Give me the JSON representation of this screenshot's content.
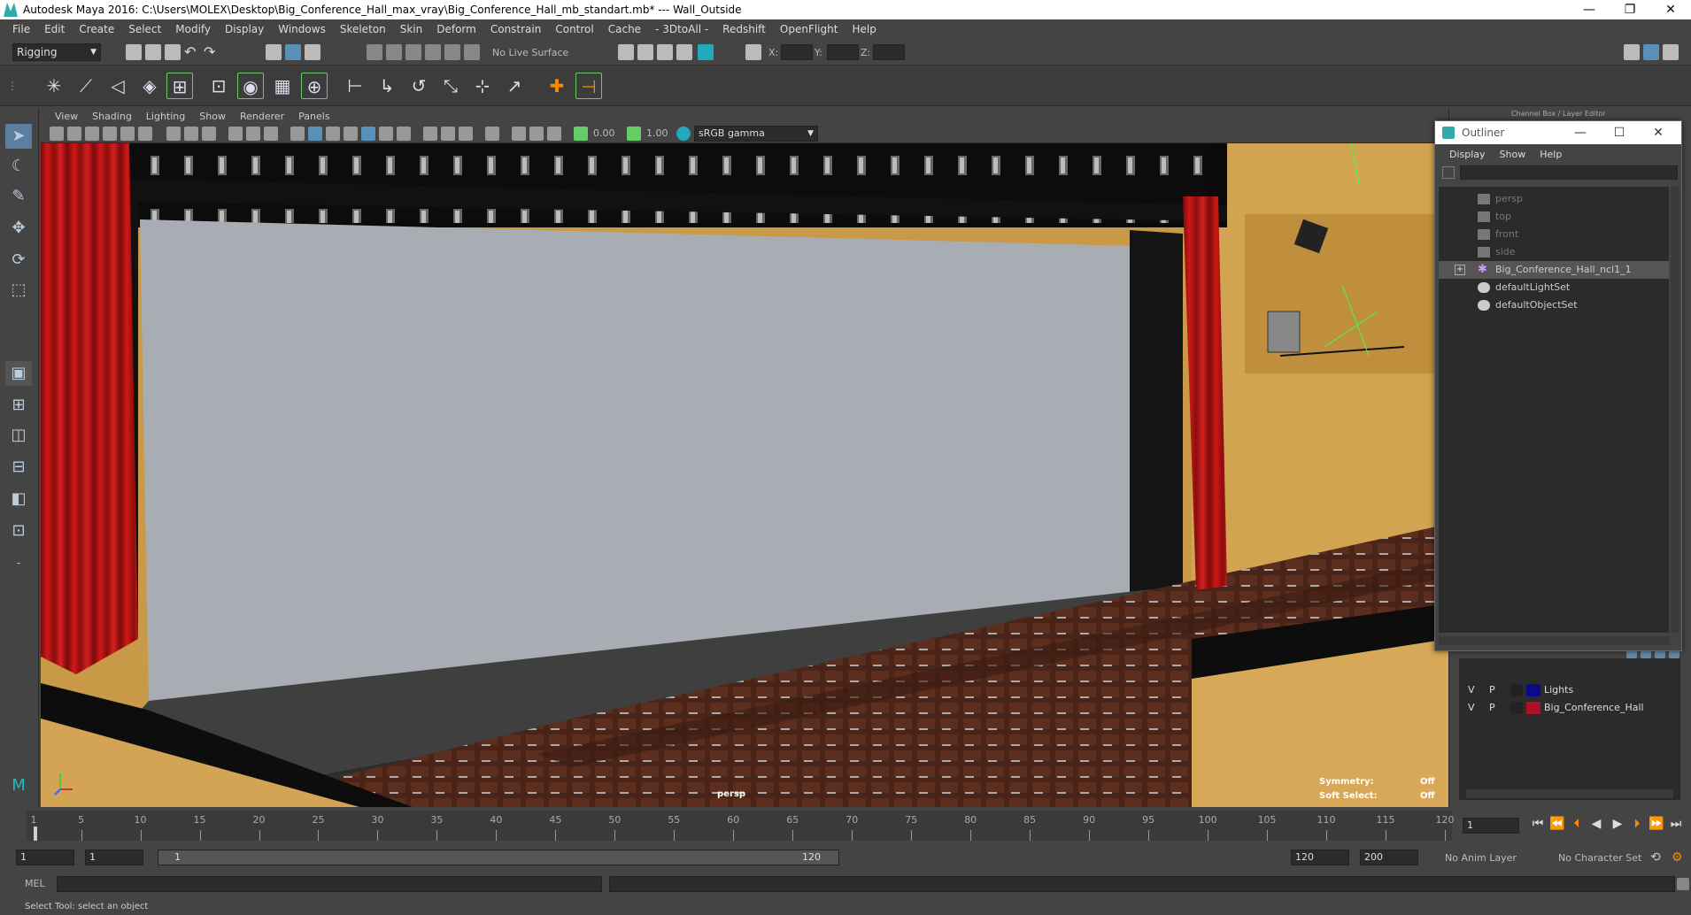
{
  "window": {
    "title": "Autodesk Maya 2016: C:\\Users\\MOLEX\\Desktop\\Big_Conference_Hall_max_vray\\Big_Conference_Hall_mb_standart.mb*   ---   Wall_Outside",
    "minimize": "—",
    "restore": "❐",
    "close": "✕"
  },
  "menubar": [
    "File",
    "Edit",
    "Create",
    "Select",
    "Modify",
    "Display",
    "Windows",
    "Skeleton",
    "Skin",
    "Deform",
    "Constrain",
    "Control",
    "Cache",
    "- 3DtoAll -",
    "Redshift",
    "OpenFlight",
    "Help"
  ],
  "statusline": {
    "menuset": "Rigging",
    "live_surface": "No Live Surface",
    "x_label": "X:",
    "y_label": "Y:",
    "z_label": "Z:"
  },
  "viewport": {
    "menu": [
      "View",
      "Shading",
      "Lighting",
      "Show",
      "Renderer",
      "Panels"
    ],
    "exposure": "0.00",
    "gamma": "1.00",
    "color_space": "sRGB gamma",
    "camera_label": "persp",
    "symmetry_label": "Symmetry:",
    "symmetry_value": "Off",
    "soft_select_label": "Soft Select:",
    "soft_select_value": "Off"
  },
  "channel_box_title": "Channel Box / Layer Editor",
  "outliner": {
    "title": "Outliner",
    "menu": [
      "Display",
      "Show",
      "Help"
    ],
    "items": [
      {
        "label": "persp",
        "type": "camera",
        "dim": true
      },
      {
        "label": "top",
        "type": "camera",
        "dim": true
      },
      {
        "label": "front",
        "type": "camera",
        "dim": true
      },
      {
        "label": "side",
        "type": "camera",
        "dim": true
      },
      {
        "label": "Big_Conference_Hall_ncl1_1",
        "type": "group",
        "dim": false
      },
      {
        "label": "defaultLightSet",
        "type": "set",
        "dim": false
      },
      {
        "label": "defaultObjectSet",
        "type": "set",
        "dim": false
      }
    ]
  },
  "layers": [
    {
      "v": "V",
      "p": "P",
      "name": "Lights",
      "color": "#0a0a8a"
    },
    {
      "v": "V",
      "p": "P",
      "name": "Big_Conference_Hall",
      "color": "#b0102a"
    }
  ],
  "timeline": {
    "ticks": [
      "1",
      "5",
      "10",
      "15",
      "20",
      "25",
      "30",
      "35",
      "40",
      "45",
      "50",
      "55",
      "60",
      "65",
      "70",
      "75",
      "80",
      "85",
      "90",
      "95",
      "100",
      "105",
      "110",
      "115",
      "120"
    ],
    "current_frame": "1"
  },
  "range": {
    "start": "1",
    "playback_start": "1",
    "slider_start": "1",
    "slider_end": "120",
    "playback_end": "120",
    "end": "200",
    "anim_layer": "No Anim Layer",
    "char_set": "No Character Set"
  },
  "cmdline": {
    "label": "MEL"
  },
  "helpline": "Select Tool: select an object"
}
